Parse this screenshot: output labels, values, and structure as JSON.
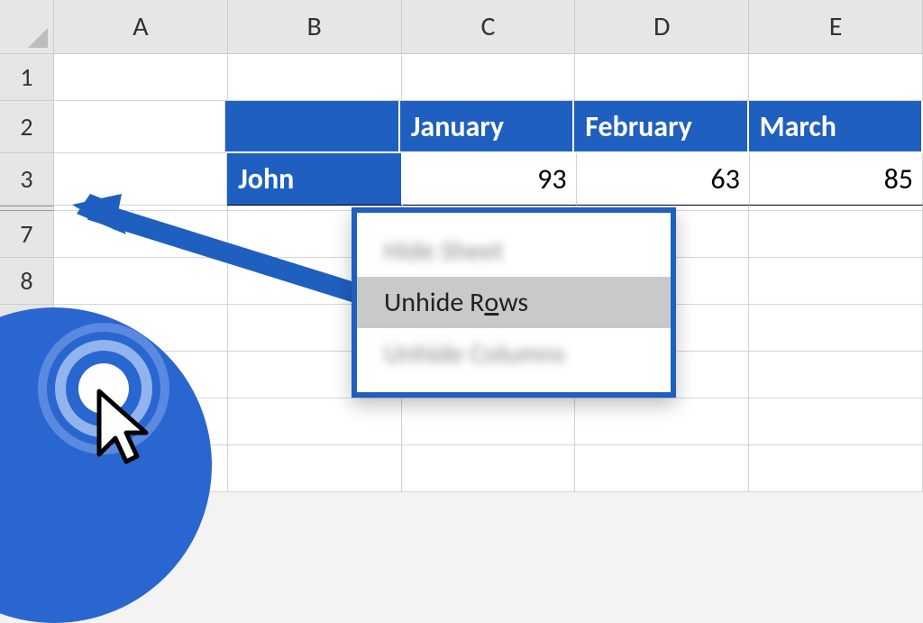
{
  "columns": [
    "A",
    "B",
    "C",
    "D",
    "E"
  ],
  "row_labels": {
    "r1": "1",
    "r2": "2",
    "r3": "3",
    "r7": "7",
    "r8": "8"
  },
  "table": {
    "headers": {
      "c": "January",
      "d": "February",
      "e": "March"
    },
    "data_row": {
      "name": "John",
      "c": "93",
      "d": "63",
      "e": "85"
    }
  },
  "menu": {
    "item1": "Hide Sheet",
    "item2_pre": "Unhide R",
    "item2_u": "o",
    "item2_post": "ws",
    "item3": "Unhide Columns"
  },
  "chart_data": {
    "type": "table",
    "title": "",
    "columns": [
      "January",
      "February",
      "March"
    ],
    "rows": [
      {
        "name": "John",
        "values": [
          93,
          63,
          85
        ]
      }
    ]
  }
}
